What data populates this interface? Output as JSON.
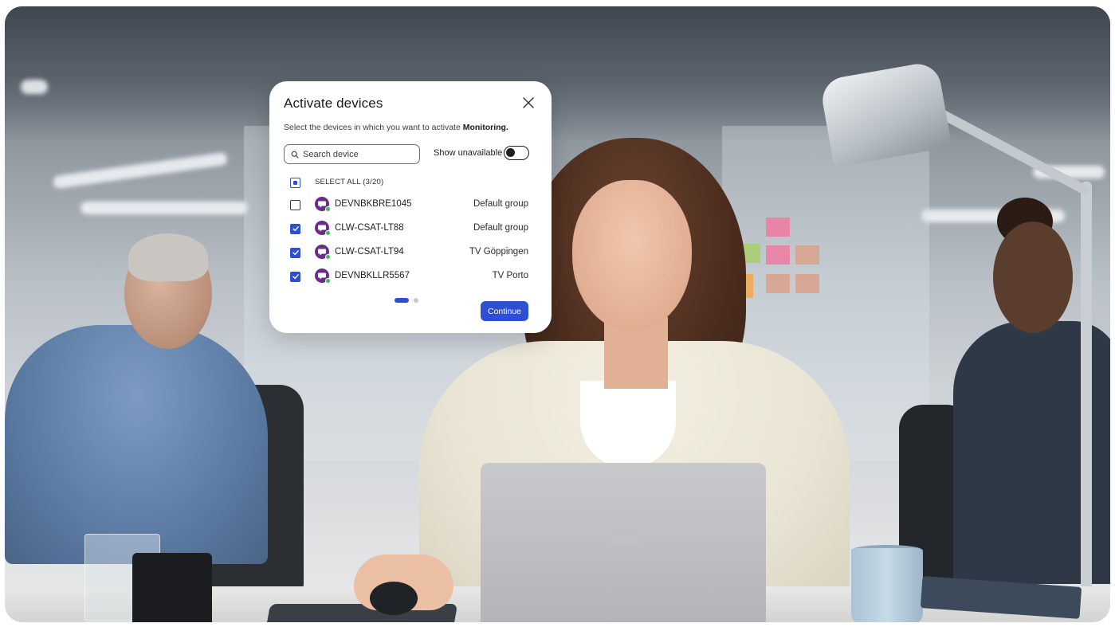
{
  "dialog": {
    "title": "Activate devices",
    "subtitle_prefix": "Select the devices in which you want to activate ",
    "subtitle_feature": "Monitoring.",
    "search": {
      "placeholder": "Search device",
      "value": ""
    },
    "show_unavailable": {
      "label": "Show unavailable",
      "enabled": false
    },
    "select_all": {
      "label": "SELECT ALL (3/20)",
      "state": "partial"
    },
    "devices": [
      {
        "name": "DEVNBKBRE1045",
        "group": "Default group",
        "checked": false,
        "online": true
      },
      {
        "name": "CLW-CSAT-LT88",
        "group": "Default group",
        "checked": true,
        "online": true
      },
      {
        "name": "CLW-CSAT-LT94",
        "group": "TV Göppingen",
        "checked": true,
        "online": true
      },
      {
        "name": "DEVNBKLLR5567",
        "group": "TV Porto",
        "checked": true,
        "online": true
      }
    ],
    "pagination": {
      "current_page": 1,
      "total_pages": 2
    },
    "continue_label": "Continue",
    "colors": {
      "accent": "#2f4fd3",
      "avatar": "#6b2d8a",
      "online": "#3bbd5a"
    }
  }
}
